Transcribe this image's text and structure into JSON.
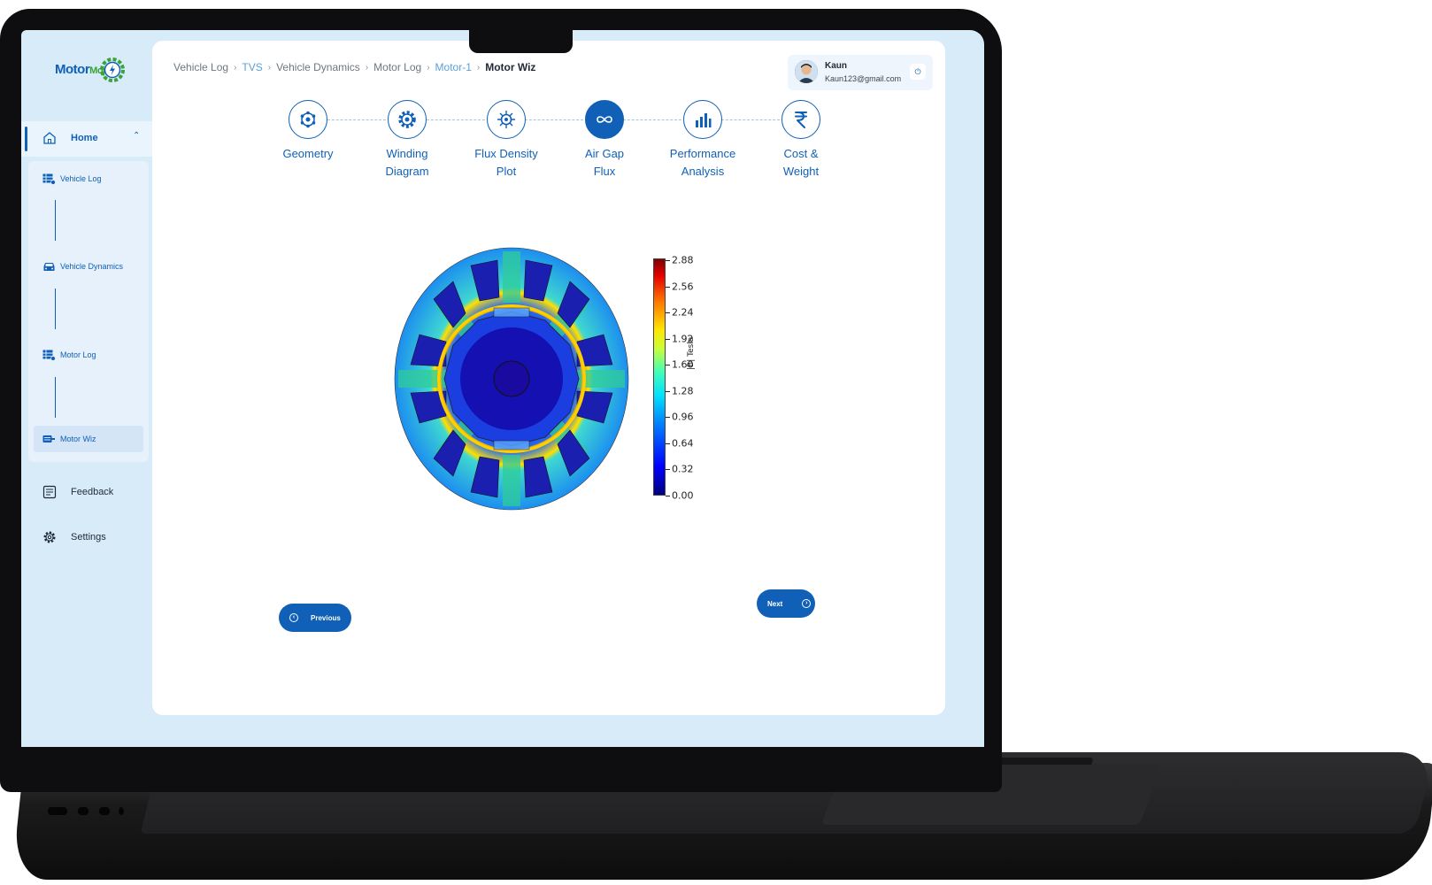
{
  "brand": {
    "logo_text_1": "Motor",
    "logo_text_2": "Mojo"
  },
  "sidebar": {
    "home_label": "Home",
    "sub_items": [
      {
        "label": "Vehicle Log",
        "icon": "table-icon"
      },
      {
        "label": "Vehicle Dynamics",
        "icon": "car-icon"
      },
      {
        "label": "Motor Log",
        "icon": "table-icon"
      },
      {
        "label": "Motor Wiz",
        "icon": "motor-icon"
      }
    ],
    "items": [
      {
        "label": "Feedback",
        "icon": "feedback-icon"
      },
      {
        "label": "Settings",
        "icon": "gear-icon"
      }
    ]
  },
  "breadcrumb": [
    "Vehicle Log",
    "TVS",
    "Vehicle Dynamics",
    "Motor Log",
    "Motor-1",
    "Motor Wiz"
  ],
  "user": {
    "name": "Kaun",
    "email": "Kaun123@gmail.com"
  },
  "steps": [
    {
      "line1": "Geometry",
      "line2": "",
      "icon": "geometry-icon"
    },
    {
      "line1": "Winding",
      "line2": "Diagram",
      "icon": "gear-icon"
    },
    {
      "line1": "Flux Density",
      "line2": "Plot",
      "icon": "flux-icon"
    },
    {
      "line1": "Air Gap",
      "line2": "Flux",
      "icon": "infinity-icon",
      "active": true
    },
    {
      "line1": "Performance",
      "line2": "Analysis",
      "icon": "bar-chart-icon"
    },
    {
      "line1": "Cost &",
      "line2": "Weight",
      "icon": "rupee-icon"
    }
  ],
  "colorbar": {
    "title": "|B| Tesla",
    "ticks": [
      "2.88",
      "2.56",
      "2.24",
      "1.92",
      "1.60",
      "1.28",
      "0.96",
      "0.64",
      "0.32",
      "0.00"
    ]
  },
  "buttons": {
    "previous": "Previous",
    "next": "Next"
  },
  "colors": {
    "primary": "#1060b8",
    "accent_green": "#3aa23a",
    "screen_bg": "#d8ebf9"
  }
}
